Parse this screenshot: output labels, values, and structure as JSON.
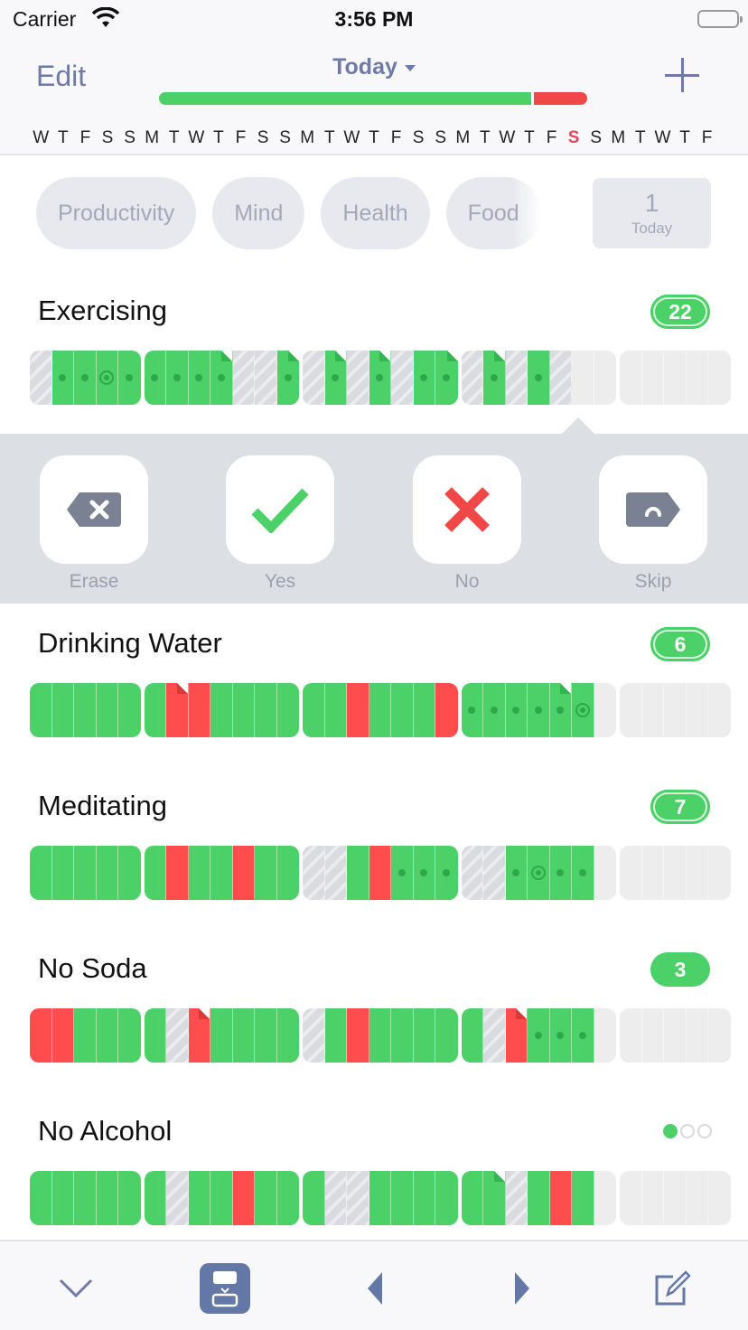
{
  "status_bar": {
    "carrier": "Carrier",
    "time": "3:56 PM",
    "wifi_icon": "wifi-icon",
    "battery_icon": "battery-icon"
  },
  "nav": {
    "edit_label": "Edit",
    "title": "Today",
    "add_icon": "plus-icon",
    "progress": {
      "done_fraction": 0.87,
      "colors": {
        "done": "#4cd068",
        "fail": "#f04848"
      }
    }
  },
  "days": [
    "W",
    "T",
    "F",
    "S",
    "S",
    "M",
    "T",
    "W",
    "T",
    "F",
    "S",
    "S",
    "M",
    "T",
    "W",
    "T",
    "F",
    "S",
    "S",
    "M",
    "T",
    "W",
    "T",
    "F",
    "S",
    "S",
    "M",
    "T",
    "W",
    "T",
    "F"
  ],
  "today_index": 24,
  "filters": [
    "Productivity",
    "Mind",
    "Health",
    "Food"
  ],
  "today_box": {
    "count": "1",
    "label": "Today"
  },
  "legend": {
    "G": "done",
    "R": "failed",
    "S": "skipped",
    "E": "empty",
    "d": "dot",
    "r": "ring",
    "n": "note"
  },
  "habits": [
    {
      "name": "Exercising",
      "badge": "22",
      "badge_style": "ring",
      "weeks": [
        [
          "S",
          "Gd",
          "Gd",
          "Gr",
          "Gd"
        ],
        [
          "Gd",
          "Gd",
          "Gd",
          "Gdn",
          "S",
          "S",
          "Gdn"
        ],
        [
          "S",
          "Gdn",
          "S",
          "Gdn",
          "S",
          "Gd",
          "Gdn"
        ],
        [
          "S",
          "Gdn",
          "S",
          "Gd",
          "S",
          "E",
          "E"
        ],
        [
          "E",
          "E",
          "E",
          "E",
          "E"
        ]
      ]
    },
    {
      "name": "Drinking Water",
      "badge": "6",
      "badge_style": "ring",
      "weeks": [
        [
          "G",
          "G",
          "G",
          "G",
          "G"
        ],
        [
          "G",
          "Rn",
          "R",
          "G",
          "G",
          "G",
          "G"
        ],
        [
          "G",
          "G",
          "R",
          "G",
          "G",
          "G",
          "R"
        ],
        [
          "Gd",
          "Gd",
          "Gd",
          "Gd",
          "Gdn",
          "Gr",
          "E"
        ],
        [
          "E",
          "E",
          "E",
          "E",
          "E"
        ]
      ]
    },
    {
      "name": "Meditating",
      "badge": "7",
      "badge_style": "ring",
      "weeks": [
        [
          "G",
          "G",
          "G",
          "G",
          "G"
        ],
        [
          "G",
          "R",
          "G",
          "G",
          "R",
          "G",
          "G"
        ],
        [
          "S",
          "S",
          "G",
          "R",
          "Gd",
          "Gd",
          "Gd"
        ],
        [
          "S",
          "S",
          "Gd",
          "Gr",
          "Gd",
          "Gd",
          "E"
        ],
        [
          "E",
          "E",
          "E",
          "E",
          "E"
        ]
      ]
    },
    {
      "name": "No Soda",
      "badge": "3",
      "badge_style": "solid",
      "weeks": [
        [
          "R",
          "R",
          "G",
          "G",
          "G"
        ],
        [
          "G",
          "S",
          "Rn",
          "G",
          "G",
          "G",
          "G"
        ],
        [
          "S",
          "G",
          "R",
          "G",
          "G",
          "G",
          "G"
        ],
        [
          "G",
          "S",
          "Rn",
          "Gd",
          "Gd",
          "Gd",
          "E"
        ],
        [
          "E",
          "E",
          "E",
          "E",
          "E"
        ]
      ]
    },
    {
      "name": "No Alcohol",
      "badge": null,
      "dots": [
        true,
        false,
        false
      ],
      "weeks": [
        [
          "G",
          "G",
          "G",
          "G",
          "G"
        ],
        [
          "G",
          "S",
          "G",
          "G",
          "R",
          "G",
          "G"
        ],
        [
          "G",
          "S",
          "S",
          "G",
          "G",
          "G",
          "G"
        ],
        [
          "G",
          "Gn",
          "S",
          "G",
          "R",
          "G",
          "E"
        ],
        [
          "E",
          "E",
          "E",
          "E",
          "E"
        ]
      ]
    }
  ],
  "actions": [
    {
      "label": "Erase",
      "icon": "erase-icon"
    },
    {
      "label": "Yes",
      "icon": "checkmark-icon"
    },
    {
      "label": "No",
      "icon": "x-icon"
    },
    {
      "label": "Skip",
      "icon": "skip-tag-icon"
    }
  ],
  "toolbar": [
    "collapse-chevron-icon",
    "move-today-icon",
    "previous-icon",
    "next-icon",
    "compose-icon"
  ]
}
